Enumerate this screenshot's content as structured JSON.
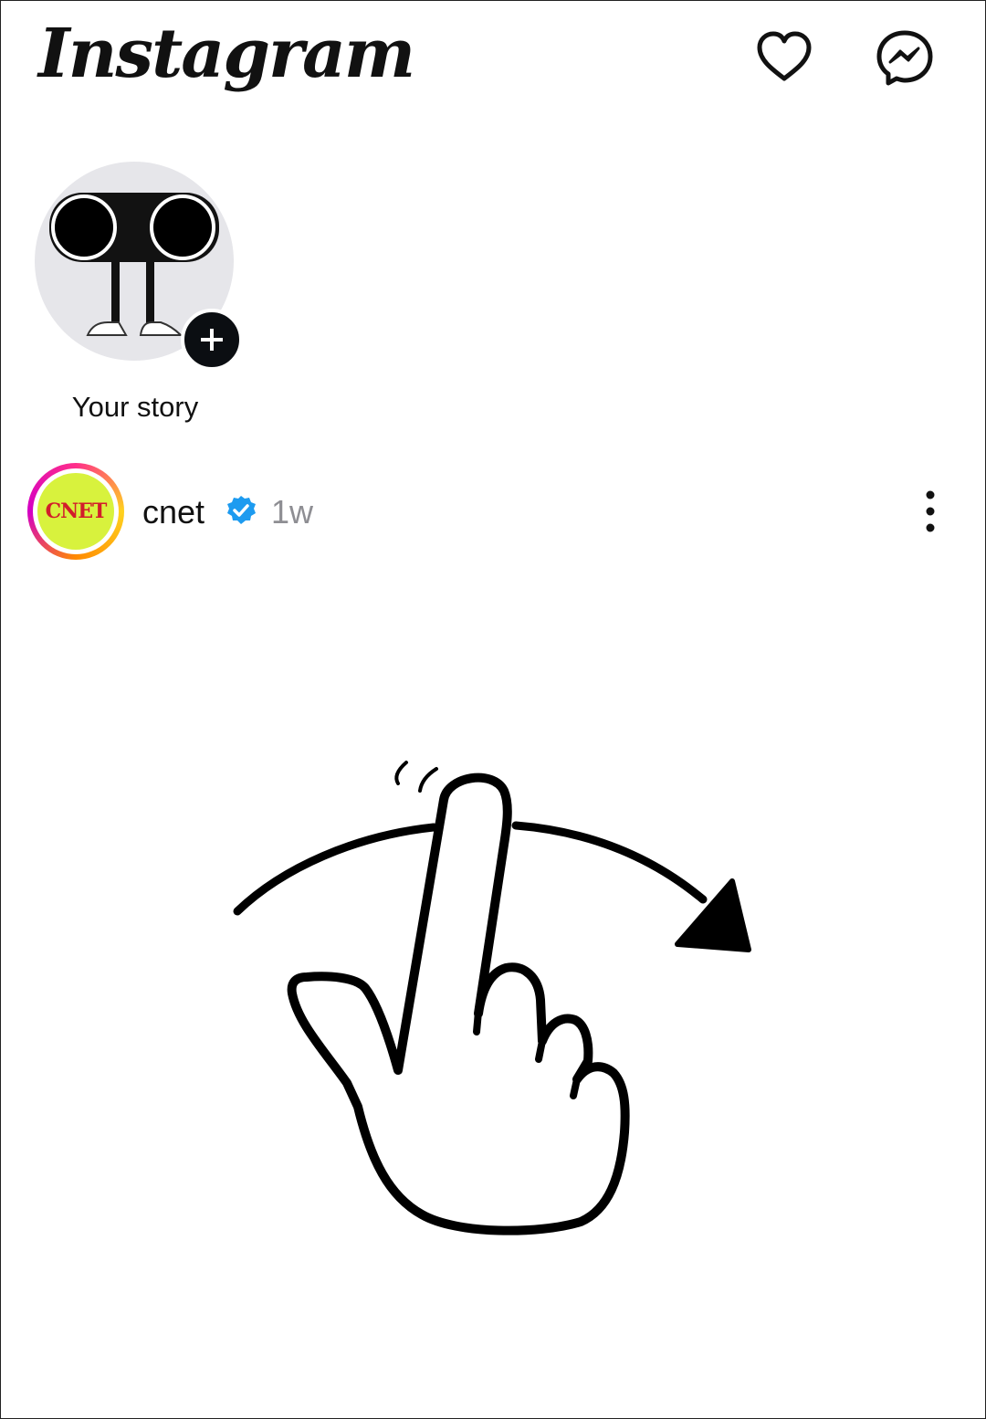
{
  "header": {
    "logo_text": "Instagram"
  },
  "stories": [
    {
      "label": "Your story"
    }
  ],
  "post": {
    "username": "cnet",
    "avatar_text": "CNET",
    "time_ago": "1w"
  },
  "colors": {
    "verified_blue": "#1d9bf0",
    "avatar_green": "#d8f23d",
    "cnet_red": "#d21d2b"
  }
}
